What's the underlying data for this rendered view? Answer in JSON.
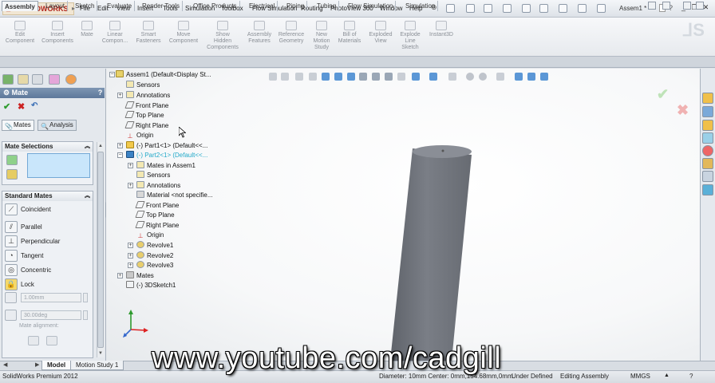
{
  "app": {
    "logo_text": "SOLIDWORKS",
    "document_title": "Assem1 *",
    "help_glyph": "?"
  },
  "menu": [
    "File",
    "Edit",
    "View",
    "Insert",
    "Tools",
    "Simulation",
    "Toolbox",
    "Flow Simulation",
    "Routing",
    "PhotoView 360",
    "Window",
    "Help"
  ],
  "command_manager": [
    {
      "label": "Edit\nComponent",
      "icon": "edit-component-icon"
    },
    {
      "label": "Insert\nComponents",
      "icon": "insert-components-icon"
    },
    {
      "label": "Mate",
      "icon": "mate-icon"
    },
    {
      "label": "Linear\nCompon...",
      "icon": "linear-pattern-icon"
    },
    {
      "label": "Smart\nFasteners",
      "icon": "smart-fasteners-icon"
    },
    {
      "label": "Move\nComponent",
      "icon": "move-component-icon"
    },
    {
      "label": "Show\nHidden\nComponents",
      "icon": "show-hidden-icon"
    },
    {
      "label": "Assembly\nFeatures",
      "icon": "assembly-features-icon"
    },
    {
      "label": "Reference\nGeometry",
      "icon": "reference-geometry-icon"
    },
    {
      "label": "New\nMotion\nStudy",
      "icon": "new-motion-study-icon"
    },
    {
      "label": "Bill of\nMaterials",
      "icon": "bill-of-materials-icon"
    },
    {
      "label": "Exploded\nView",
      "icon": "exploded-view-icon"
    },
    {
      "label": "Explode\nLine\nSketch",
      "icon": "explode-line-sketch-icon"
    },
    {
      "label": "Instant3D",
      "icon": "instant3d-icon"
    }
  ],
  "tabs": [
    "Assembly",
    "Layout",
    "Sketch",
    "Evaluate",
    "Render Tools",
    "Office Products",
    "Electrical",
    "Piping",
    "Tubing",
    "Flow Simulation",
    "Simulation"
  ],
  "property_manager": {
    "title": "Mate",
    "subtabs": {
      "mates": "Mates",
      "analysis": "Analysis"
    },
    "mate_selections_label": "Mate Selections",
    "standard_mates_label": "Standard Mates",
    "mates": [
      "Coincident",
      "Parallel",
      "Perpendicular",
      "Tangent",
      "Concentric",
      "Lock"
    ],
    "distance_value": "1.00mm",
    "angle_value": "30.00deg",
    "mate_alignment_label": "Mate alignment:"
  },
  "feature_tree": {
    "root": "Assem1  (Default<Display St...",
    "sensors": "Sensors",
    "annotations": "Annotations",
    "front_plane": "Front Plane",
    "top_plane": "Top Plane",
    "right_plane": "Right Plane",
    "origin": "Origin",
    "part1": "(-) Part1<1> (Default<<...",
    "part2": "(-) Part2<1> (Default<<...",
    "part2_children": {
      "mates_in": "Mates in Assem1",
      "sensors": "Sensors",
      "annotations": "Annotations",
      "material": "Material <not specifie...",
      "front_plane": "Front Plane",
      "top_plane": "Top Plane",
      "right_plane": "Right Plane",
      "origin": "Origin",
      "revolve1": "Revolve1",
      "revolve2": "Revolve2",
      "revolve3": "Revolve3"
    },
    "mates": "Mates",
    "sketch": "(-) 3DSketch1"
  },
  "bottom_tabs": [
    "Model",
    "Motion Study 1"
  ],
  "status": {
    "product": "SolidWorks Premium 2012",
    "measure": "Diameter: 10mm  Center: 0mm,154.68mm,0mm",
    "state": "Under Defined",
    "mode": "Editing Assembly",
    "units": "MMGS",
    "help": "?"
  },
  "watermark": "www.youtube.com/cadgill",
  "colors": {
    "accent_header": "#5d789a",
    "selection_box": "#c9e6fb",
    "highlight_text": "#23a9c9",
    "cylinder": "#6f737a"
  }
}
